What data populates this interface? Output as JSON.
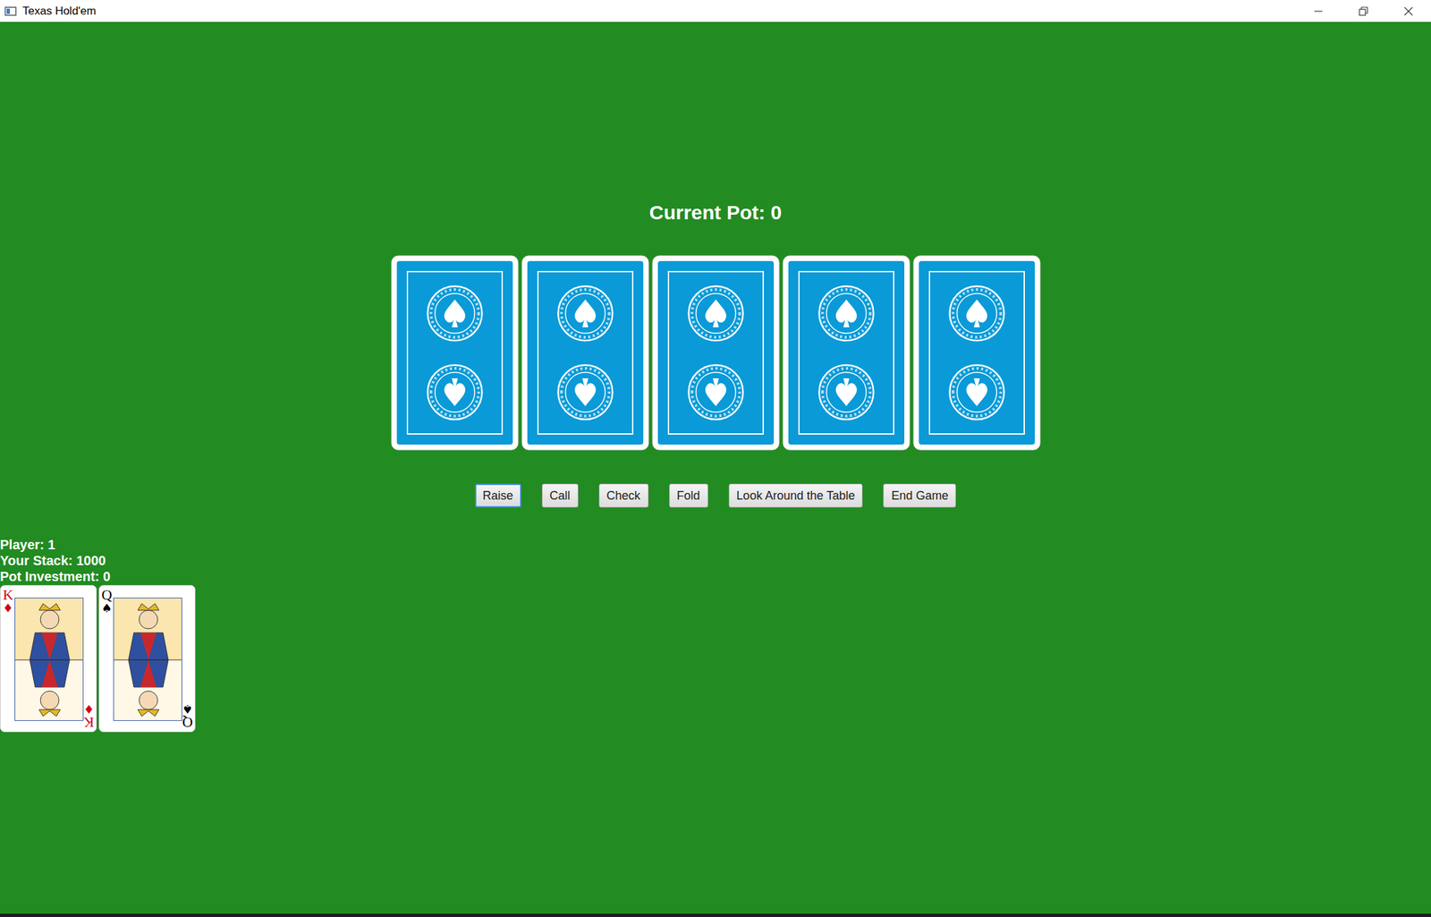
{
  "window": {
    "title": "Texas Hold'em"
  },
  "pot": "Current Pot: 0",
  "community_cards": [
    {
      "face_down": true
    },
    {
      "face_down": true
    },
    {
      "face_down": true
    },
    {
      "face_down": true
    },
    {
      "face_down": true
    }
  ],
  "buttons": [
    {
      "label": "Raise",
      "focused": true
    },
    {
      "label": "Call",
      "focused": false
    },
    {
      "label": "Check",
      "focused": false
    },
    {
      "label": "Fold",
      "focused": false
    },
    {
      "label": "Look Around the Table",
      "focused": false
    },
    {
      "label": "End Game",
      "focused": false
    }
  ],
  "player": {
    "lines": [
      "Player: 1",
      "Your Stack: 1000",
      "Pot Investment: 0"
    ],
    "cards": [
      {
        "rank": "K",
        "suit": "♦",
        "color": "#d0021b"
      },
      {
        "rank": "Q",
        "suit": "♠",
        "color": "#000000"
      }
    ]
  }
}
